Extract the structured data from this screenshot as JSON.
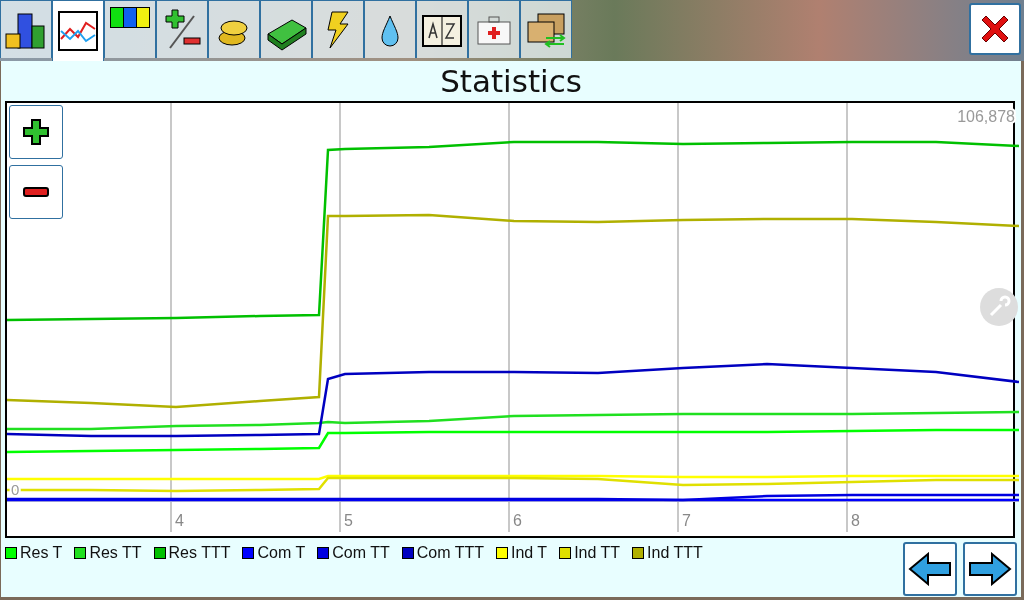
{
  "toolbar": {
    "tabs": [
      {
        "kind": "city",
        "selected": false
      },
      {
        "kind": "graph",
        "selected": true
      },
      {
        "kind": "colors",
        "selected": false
      },
      {
        "kind": "plusminus",
        "selected": false
      },
      {
        "kind": "coins",
        "selected": false
      },
      {
        "kind": "money",
        "selected": false
      },
      {
        "kind": "bolt",
        "selected": false
      },
      {
        "kind": "drop",
        "selected": false
      },
      {
        "kind": "book",
        "selected": false
      },
      {
        "kind": "medkit",
        "selected": false
      },
      {
        "kind": "swap",
        "selected": false
      }
    ]
  },
  "title": "Statistics",
  "chart": {
    "x_labels": [
      "4",
      "5",
      "6",
      "7",
      "8"
    ],
    "max_label": "106,878",
    "zero_label": "0"
  },
  "legend": [
    {
      "label": "Res T",
      "color": "#00ff00"
    },
    {
      "label": "Res TT",
      "color": "#20e020"
    },
    {
      "label": "Res TTT",
      "color": "#00c000"
    },
    {
      "label": "Com T",
      "color": "#0000ff"
    },
    {
      "label": "Com TT",
      "color": "#0000e0"
    },
    {
      "label": "Com TTT",
      "color": "#0000c0"
    },
    {
      "label": "Ind T",
      "color": "#ffff00"
    },
    {
      "label": "Ind TT",
      "color": "#e0e000"
    },
    {
      "label": "Ind TTT",
      "color": "#b0b000"
    }
  ]
}
